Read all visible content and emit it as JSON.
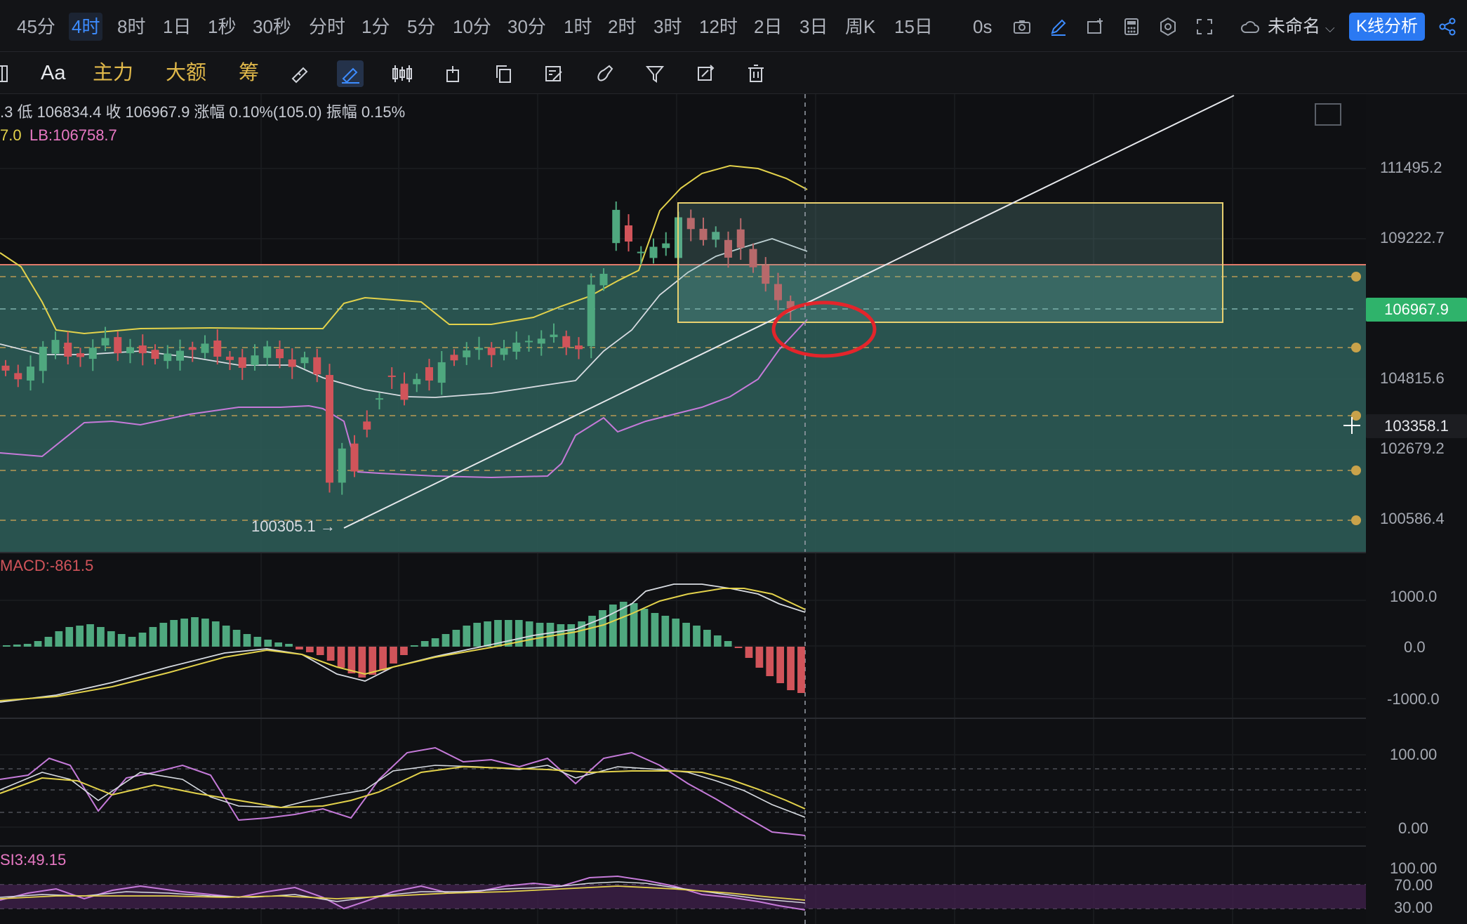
{
  "toolbar": {
    "timeframes": [
      "45分",
      "4时",
      "8时",
      "1日",
      "1秒",
      "30秒",
      "分时",
      "1分",
      "5分",
      "10分",
      "30分",
      "1时",
      "2时",
      "3时",
      "12时",
      "2日",
      "3日",
      "周K",
      "15日"
    ],
    "active_timeframe": "4时",
    "latency": "0s",
    "account_name": "未命名",
    "kline_button": "K线分析"
  },
  "drawbar": {
    "font_label": "Aa",
    "indicator_main": "主力",
    "indicator_large": "大额",
    "indicator_chip": "筹"
  },
  "info": {
    "ohlc_line": ".3 低 106834.4 收 106967.9 涨幅 0.10%(105.0) 振幅 0.15%",
    "lb_prefix": "7.0",
    "lb_line": "LB:106758.7"
  },
  "price_axis": {
    "labels": [
      "111495.2",
      "109222.7",
      "104815.6",
      "102679.2",
      "100586.4"
    ],
    "current_price": "106967.9",
    "crosshair_price": "103358.1"
  },
  "annotations": {
    "low_marker": "100305.1 →"
  },
  "macd": {
    "label": "MACD:-861.5",
    "axis": [
      "1000.0",
      "0.0",
      "-1000.0"
    ]
  },
  "kdj": {
    "axis": [
      "100.00",
      "0.00"
    ]
  },
  "rsi": {
    "label": "SI3:49.15",
    "axis": [
      "100.00",
      "70.00",
      "30.00"
    ]
  },
  "colors": {
    "up": "#4fa87f",
    "down": "#d1545a",
    "accent": "#2b79f2",
    "boll_upper": "#e3d24b",
    "boll_mid": "#d8dce2",
    "boll_lower": "#c57ad9",
    "zone_fill": "#2e5f5a",
    "box_outline": "#e8d070",
    "highlight_circle": "#e3252b"
  },
  "chart_data": {
    "type": "candlestick",
    "series": [
      {
        "name": "K",
        "open": [
          105120,
          104880,
          104640,
          104950,
          105510,
          105860,
          105520,
          105340,
          105770,
          106040,
          105520,
          105770,
          105630,
          105270,
          105280,
          105710,
          105530,
          105930,
          105410,
          105390,
          105140,
          105370,
          105660,
          105320,
          105200,
          105390,
          104820,
          101350,
          102610,
          103320,
          104030,
          104800,
          104540,
          104520,
          105070,
          104570,
          105470,
          105390,
          105630,
          105700,
          105470,
          105570,
          105890,
          105830,
          106040,
          106070,
          105770,
          105750,
          107710,
          109070,
          109640,
          108770,
          108590,
          108910,
          108590,
          109880,
          109530,
          109180,
          109170,
          109510,
          108880,
          108350,
          107750,
          107200
        ],
        "close": [
          104960,
          104680,
          105090,
          105730,
          105950,
          105410,
          105400,
          105700,
          106010,
          105520,
          105710,
          105520,
          105340,
          105510,
          105600,
          105630,
          105830,
          105410,
          105300,
          105050,
          105450,
          105740,
          105360,
          105080,
          105390,
          104840,
          101350,
          102450,
          101710,
          103060,
          104070,
          104760,
          104020,
          104690,
          104640,
          105230,
          105290,
          105610,
          105690,
          105460,
          105680,
          105860,
          105920,
          105990,
          106120,
          105710,
          105650,
          107730,
          108080,
          110140,
          109120,
          108790,
          108950,
          109060,
          109900,
          109520,
          109170,
          109430,
          108600,
          108920,
          108290,
          107760,
          107230,
          106970
        ]
      }
    ],
    "price_ticks": [
      111495.2,
      109222.7,
      104815.6,
      102679.2,
      100586.4
    ],
    "current_price": 106967.9,
    "macd_value": -861.5,
    "rsi3": 49.15
  }
}
